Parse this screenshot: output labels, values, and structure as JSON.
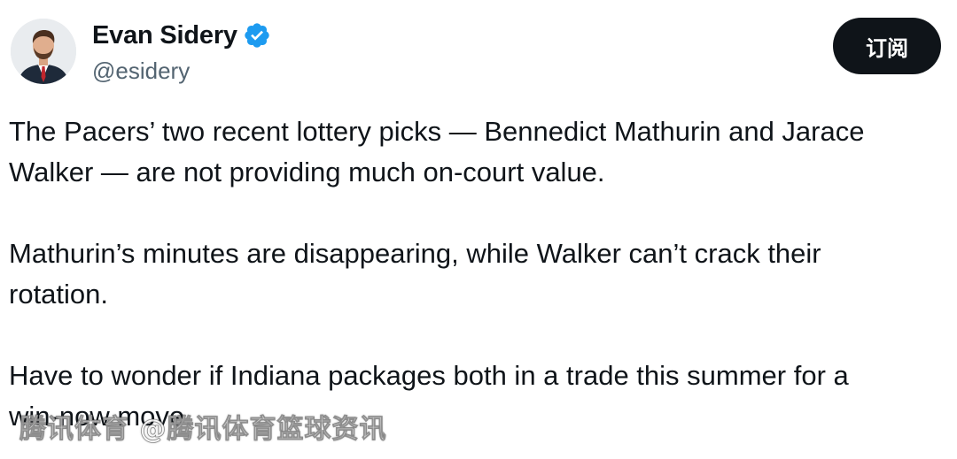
{
  "author": {
    "display_name": "Evan Sidery",
    "handle": "@esidery",
    "verified_icon": "verified-badge-icon",
    "verified_color": "#1d9bf0"
  },
  "subscribe_button": {
    "label": "订阅"
  },
  "tweet": {
    "paragraphs": [
      "The Pacers’ two recent lottery picks — Bennedict Mathurin and Jarace\nWalker — are not providing much on-court value.",
      "Mathurin’s minutes are disappearing, while Walker can’t crack their\nrotation.",
      "Have to wonder if Indiana packages both in a trade this summer for a\nwin-now move."
    ]
  },
  "watermark": {
    "text": "腾讯体育 @腾讯体育篮球资讯"
  },
  "colors": {
    "text_primary": "#0f1419",
    "text_secondary": "#536471",
    "button_bg": "#0f1419",
    "button_text": "#ffffff"
  }
}
